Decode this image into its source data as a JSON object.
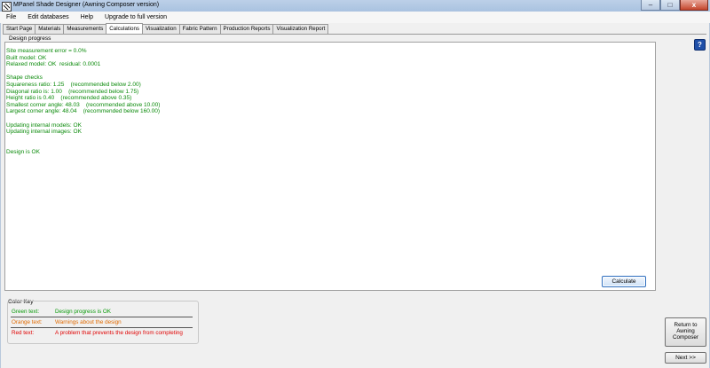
{
  "window": {
    "title": "MPanel Shade Designer (Awning Composer version)",
    "minimize_glyph": "–",
    "maximize_glyph": "□",
    "close_glyph": "x"
  },
  "menu": [
    {
      "label": "File"
    },
    {
      "label": "Edit databases"
    },
    {
      "label": "Help"
    },
    {
      "label": "Upgrade to full version"
    }
  ],
  "tabs": [
    {
      "label": "Start Page",
      "active": false
    },
    {
      "label": "Materials",
      "active": false
    },
    {
      "label": "Measurements",
      "active": false
    },
    {
      "label": "Calculations",
      "active": true
    },
    {
      "label": "Visualization",
      "active": false
    },
    {
      "label": "Fabric Pattern",
      "active": false
    },
    {
      "label": "Production Reports",
      "active": false
    },
    {
      "label": "Visualization Report",
      "active": false
    }
  ],
  "help_glyph": "?",
  "design_progress": {
    "label": "Design progress",
    "lines": [
      "Site measurement error = 0.0%",
      "Built model: OK",
      "Relaxed model: OK  residual: 0.0001",
      "",
      "Shape checks",
      "Squareness ratio: 1.25    (recommended below 2.00)",
      "Diagonal ratio is: 1.00    (recommended below 1.75)",
      "Height ratio is 0.40    (recommended above 0.35)",
      "Smallest corner angle: 48.03    (recommended above 10.00)",
      "Largest corner angle: 48.04    (recommended below 160.00)",
      "",
      "Updating internal models: OK",
      "Updating internal images: OK",
      "",
      "",
      "Design is OK"
    ],
    "text_color": "#0a8a0a",
    "calculate_label": "Calculate"
  },
  "color_key": {
    "label": "Color Key",
    "rows": [
      {
        "key": "Green text:",
        "desc": "Design progress is OK",
        "color": "green"
      },
      {
        "key": "Orange text:",
        "desc": "Warnings about the design",
        "color": "orange"
      },
      {
        "key": "Red text:",
        "desc": "A problem that prevents the design from completing",
        "color": "red"
      }
    ]
  },
  "buttons": {
    "return_label": "Return to Awning Composer",
    "next_label": "Next >>"
  }
}
